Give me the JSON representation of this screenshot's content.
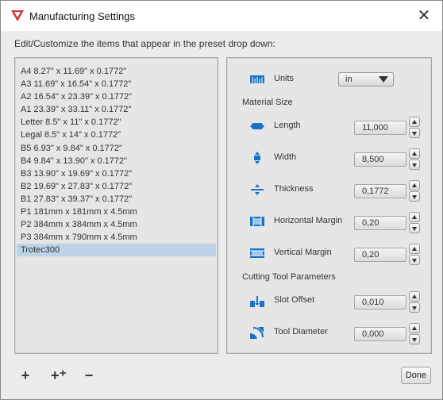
{
  "window": {
    "title": "Manufacturing Settings"
  },
  "instructions": "Edit/Customize the items that appear in the preset drop down:",
  "presets": {
    "items": [
      "A4 8.27\" x 11.69\" x 0.1772\"",
      "A3 11.69\" x 16.54\" x 0.1772\"",
      "A2 16.54\" x 23.39\" x 0.1772\"",
      "A1 23.39\" x 33.11\" x 0.1772\"",
      "Letter 8.5\" x 11\" x 0.1772\"",
      "Legal 8.5\" x 14\" x 0.1772\"",
      "B5 6.93\" x 9.84\" x 0.1772\"",
      "B4 9.84\" x 13.90\" x 0.1772\"",
      "B3 13.90\" x 19.69\" x 0.1772\"",
      "B2 19.69\" x 27.83\" x 0.1772\"",
      "B1 27.83\" x 39.37\" x 0.1772\"",
      "P1 181mm x 181mm x 4.5mm",
      "P2 384mm x 384mm x 4.5mm",
      "P3 384mm x 790mm x 4.5mm",
      "Trotec300"
    ],
    "selected_index": 14
  },
  "settings": {
    "units": {
      "label": "Units",
      "value": "in"
    },
    "material_size_heading": "Material Size",
    "length": {
      "label": "Length",
      "value": "11,000"
    },
    "width": {
      "label": "Width",
      "value": "8,500"
    },
    "thickness": {
      "label": "Thickness",
      "value": "0,1772"
    },
    "horizontal_margin": {
      "label": "Horizontal Margin",
      "value": "0,20"
    },
    "vertical_margin": {
      "label": "Vertical Margin",
      "value": "0,20"
    },
    "cutting_heading": "Cutting Tool Parameters",
    "slot_offset": {
      "label": "Slot Offset",
      "value": "0,010"
    },
    "tool_diameter": {
      "label": "Tool Diameter",
      "value": "0,000"
    }
  },
  "buttons": {
    "add": "+",
    "add_copy": "+⁺",
    "remove": "−",
    "done": "Done"
  },
  "colors": {
    "accent_icon": "#1a73c9",
    "selection": "#bcd3ea",
    "brand_red": "#d2322d"
  }
}
